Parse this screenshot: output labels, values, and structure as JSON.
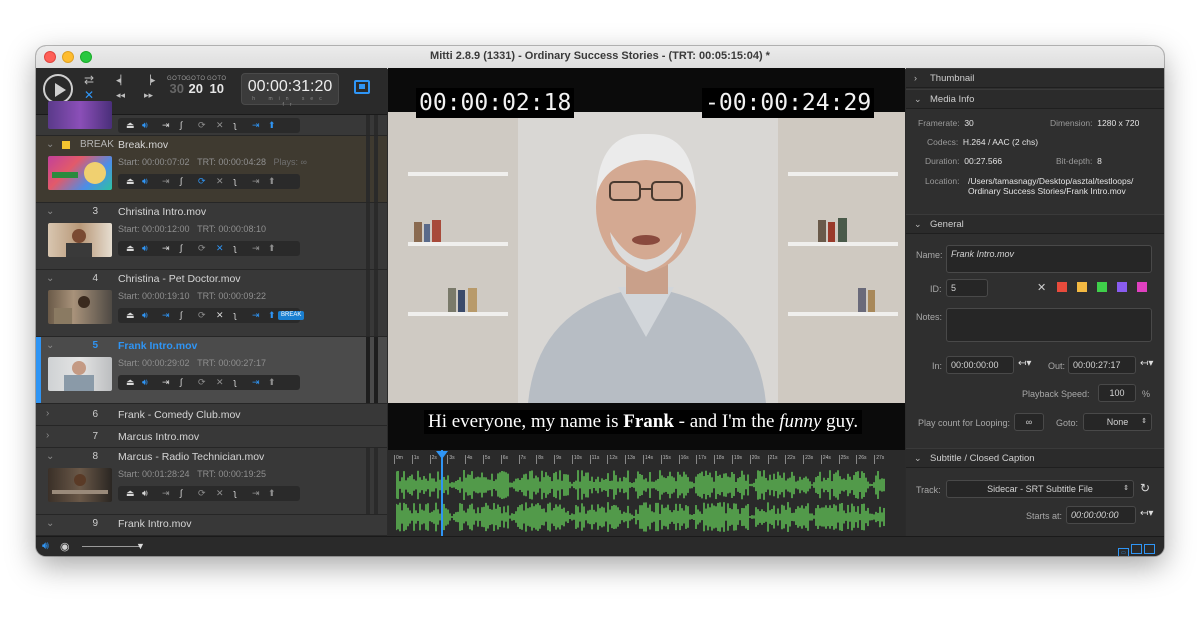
{
  "window": {
    "title": "Mitti 2.8.9 (1331) - Ordinary Success Stories - (TRT: 00:05:15:04) *"
  },
  "transport": {
    "goto_small": "GOTO",
    "goto_values": [
      "30",
      "20",
      "10"
    ],
    "timecode": "00:00:31:20",
    "timecode_units": "h min sec fr"
  },
  "cues": [
    {
      "name": "Break.mov",
      "label": "BREAK",
      "start": "Start: 00:00:07:02",
      "trt": "TRT: 00:00:04:28",
      "plays": "Plays: ∞"
    },
    {
      "num": "3",
      "name": "Christina Intro.mov",
      "start": "Start: 00:00:12:00",
      "trt": "TRT: 00:00:08:10"
    },
    {
      "num": "4",
      "name": "Christina - Pet Doctor.mov",
      "start": "Start: 00:00:19:10",
      "trt": "TRT: 00:00:09:22",
      "tag": "BREAK"
    },
    {
      "num": "5",
      "name": "Frank Intro.mov",
      "start": "Start: 00:00:29:02",
      "trt": "TRT: 00:00:27:17"
    },
    {
      "num": "6",
      "name": "Frank - Comedy Club.mov"
    },
    {
      "num": "7",
      "name": "Marcus Intro.mov"
    },
    {
      "num": "8",
      "name": "Marcus - Radio Technician.mov",
      "start": "Start: 00:01:28:24",
      "trt": "TRT: 00:00:19:25"
    },
    {
      "num": "9",
      "name": "Frank Intro.mov"
    }
  ],
  "video": {
    "elapsed": "00:00:02:18",
    "remaining": "-00:00:24:29",
    "subtitle_pre": "Hi everyone, my name is ",
    "subtitle_bold": "Frank",
    "subtitle_mid": " - and I'm the ",
    "subtitle_italic": "funny",
    "subtitle_post": " guy.",
    "ruler": [
      "0m",
      "1s",
      "2s",
      "3s",
      "4s",
      "5s",
      "6s",
      "7s",
      "8s",
      "9s",
      "10s",
      "11s",
      "12s",
      "13s",
      "14s",
      "15s",
      "16s",
      "17s",
      "18s",
      "19s",
      "20s",
      "21s",
      "22s",
      "23s",
      "24s",
      "25s",
      "26s",
      "27s"
    ],
    "playhead_fraction": 0.09
  },
  "inspector": {
    "thumbnail": "Thumbnail",
    "media_info": "Media Info",
    "framerate_label": "Framerate:",
    "framerate": "30",
    "dimension_label": "Dimension:",
    "dimension": "1280 x 720",
    "codecs_label": "Codecs:",
    "codecs": "H.264 / AAC (2 chs)",
    "duration_label": "Duration:",
    "duration": "00:27.566",
    "bitdepth_label": "Bit-depth:",
    "bitdepth": "8",
    "location_label": "Location:",
    "location_1": "/Users/tamasnagy/Desktop/asztal/testloops/",
    "location_2": "Ordinary Success Stories/Frank Intro.mov",
    "general": "General",
    "name_label": "Name:",
    "name_value": "Frank Intro.mov",
    "id_label": "ID:",
    "id_value": "5",
    "notes_label": "Notes:",
    "in_label": "In:",
    "in_value": "00:00:00:00",
    "out_label": "Out:",
    "out_value": "00:00:27:17",
    "speed_label": "Playback Speed:",
    "speed_value": "100",
    "speed_unit": "%",
    "loop_label": "Play count for Looping:",
    "loop_value": "∞",
    "goto_label": "Goto:",
    "goto_value": "None",
    "subtitle_section": "Subtitle / Closed Caption",
    "track_label": "Track:",
    "track_value": "Sidecar - SRT Subtitle File",
    "starts_label": "Starts at:",
    "starts_value": "00:00:00:00",
    "colors": [
      "#e84b3c",
      "#f4b942",
      "#3fcf4a",
      "#8a5cf0",
      "#e040c0"
    ]
  }
}
